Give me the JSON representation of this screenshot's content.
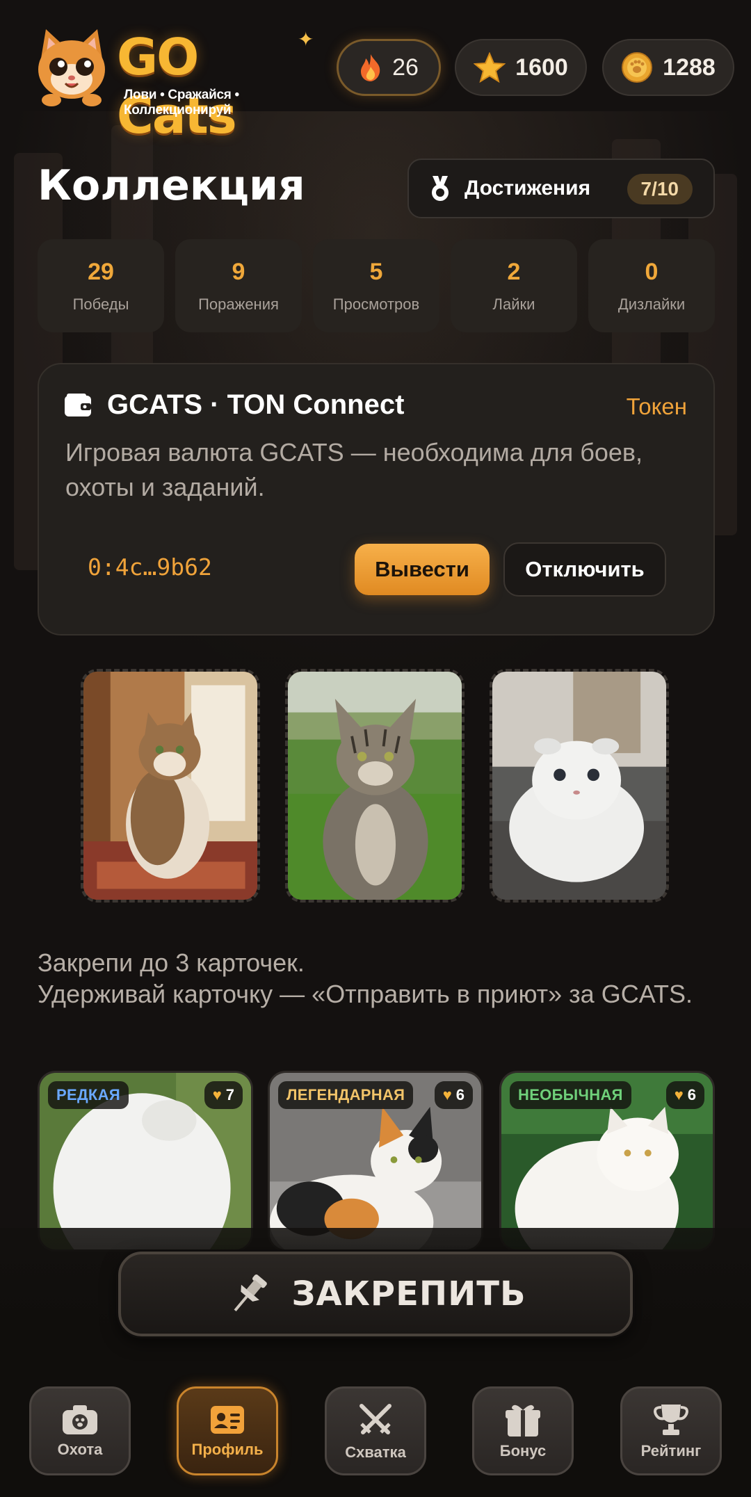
{
  "header": {
    "logo_title": "GO Cats",
    "logo_subtitle": "Лови • Сражайся • Коллекционируй",
    "streak": "26",
    "stars": "1600",
    "coins": "1288"
  },
  "collection": {
    "title": "Коллекция",
    "achievements_label": "Достижения",
    "achievements_progress": "7/10",
    "stats": [
      {
        "value": "29",
        "label": "Победы"
      },
      {
        "value": "9",
        "label": "Поражения"
      },
      {
        "value": "5",
        "label": "Просмотров"
      },
      {
        "value": "2",
        "label": "Лайки"
      },
      {
        "value": "0",
        "label": "Дизлайки"
      }
    ]
  },
  "wallet": {
    "title": "GCATS · TON Connect",
    "token_label": "Токен",
    "description": "Игровая валюта GCATS — необходима для боев, охоты и заданий.",
    "address": "0:4c…9b62",
    "withdraw_label": "Вывести",
    "disconnect_label": "Отключить"
  },
  "hint": {
    "line1": "Закрепи до 3 карточек.",
    "line2": "Удерживай карточку — «Отправить в приют» за GCATS."
  },
  "cards": [
    {
      "rarity": "РЕДКАЯ",
      "rarity_color": "#6aa8ff",
      "likes": "7"
    },
    {
      "rarity": "ЛЕГЕНДАРНАЯ",
      "rarity_color": "#f2c469",
      "likes": "6"
    },
    {
      "rarity": "НЕОБЫЧНАЯ",
      "rarity_color": "#6fd07a",
      "likes": "6"
    }
  ],
  "pin_button": {
    "label": "ЗАКРЕПИТЬ"
  },
  "nav": [
    {
      "label": "Охота",
      "icon": "camera-icon"
    },
    {
      "label": "Профиль",
      "icon": "profile-card-icon",
      "active": true
    },
    {
      "label": "Схватка",
      "icon": "crossed-swords-icon"
    },
    {
      "label": "Бонус",
      "icon": "gift-icon"
    },
    {
      "label": "Рейтинг",
      "icon": "trophy-icon"
    }
  ],
  "colors": {
    "accent": "#f0a33a",
    "background": "#141110",
    "card": "#23201d"
  }
}
